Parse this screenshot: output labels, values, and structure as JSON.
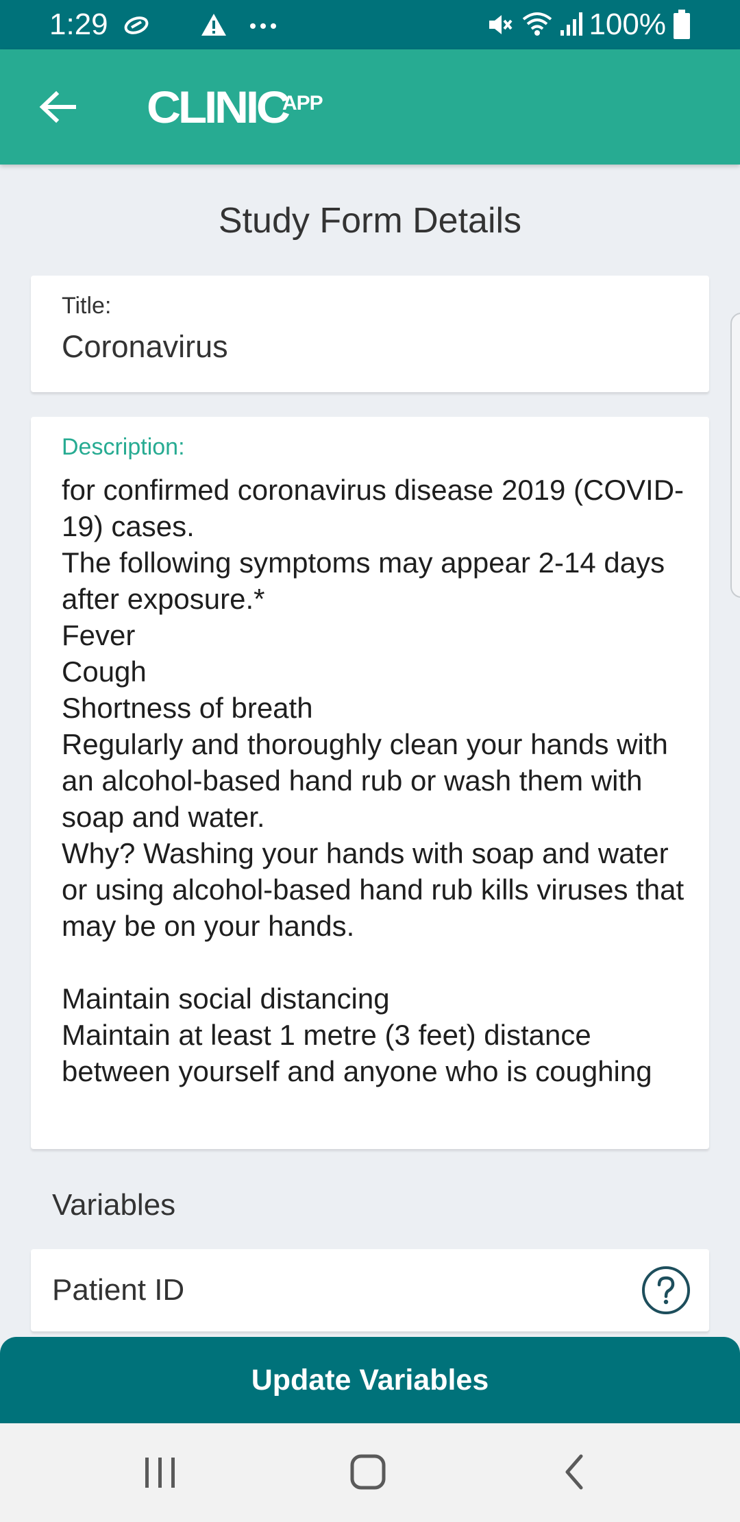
{
  "status_bar": {
    "time": "1:29",
    "battery": "100%",
    "icons": [
      "sync-icon",
      "alert-icon",
      "more-icon",
      "mute-icon",
      "wifi-icon",
      "signal-icon",
      "battery-icon"
    ]
  },
  "app_bar": {
    "back_icon": "arrow-left-icon",
    "logo_main": "CLINIC",
    "logo_sub": "APP"
  },
  "page": {
    "title": "Study Form Details"
  },
  "title_field": {
    "label": "Title:",
    "value": "Coronavirus"
  },
  "description_field": {
    "label": "Description:",
    "value": "for confirmed coronavirus disease 2019 (COVID-19) cases.\nThe following symptoms may appear 2-14 days after exposure.*\nFever\nCough\nShortness of breath\nRegularly and thoroughly clean your hands with an alcohol-based hand rub or wash them with soap and water.\nWhy? Washing your hands with soap and water or using alcohol-based hand rub kills viruses that may be on your hands.\n\nMaintain social distancing\nMaintain at least 1 metre (3 feet) distance between yourself and anyone who is coughing"
  },
  "variables": {
    "header": "Variables",
    "items": [
      {
        "label": "Patient ID",
        "icon": "help-icon"
      }
    ]
  },
  "actions": {
    "update_label": "Update Variables"
  },
  "nav_bar": {
    "buttons": [
      "recent-apps-icon",
      "home-icon",
      "back-icon"
    ]
  },
  "colors": {
    "status_bar": "#00727a",
    "app_bar": "#27ab92",
    "accent": "#27ab92",
    "primary_button": "#00727a",
    "background": "#eceff3"
  }
}
